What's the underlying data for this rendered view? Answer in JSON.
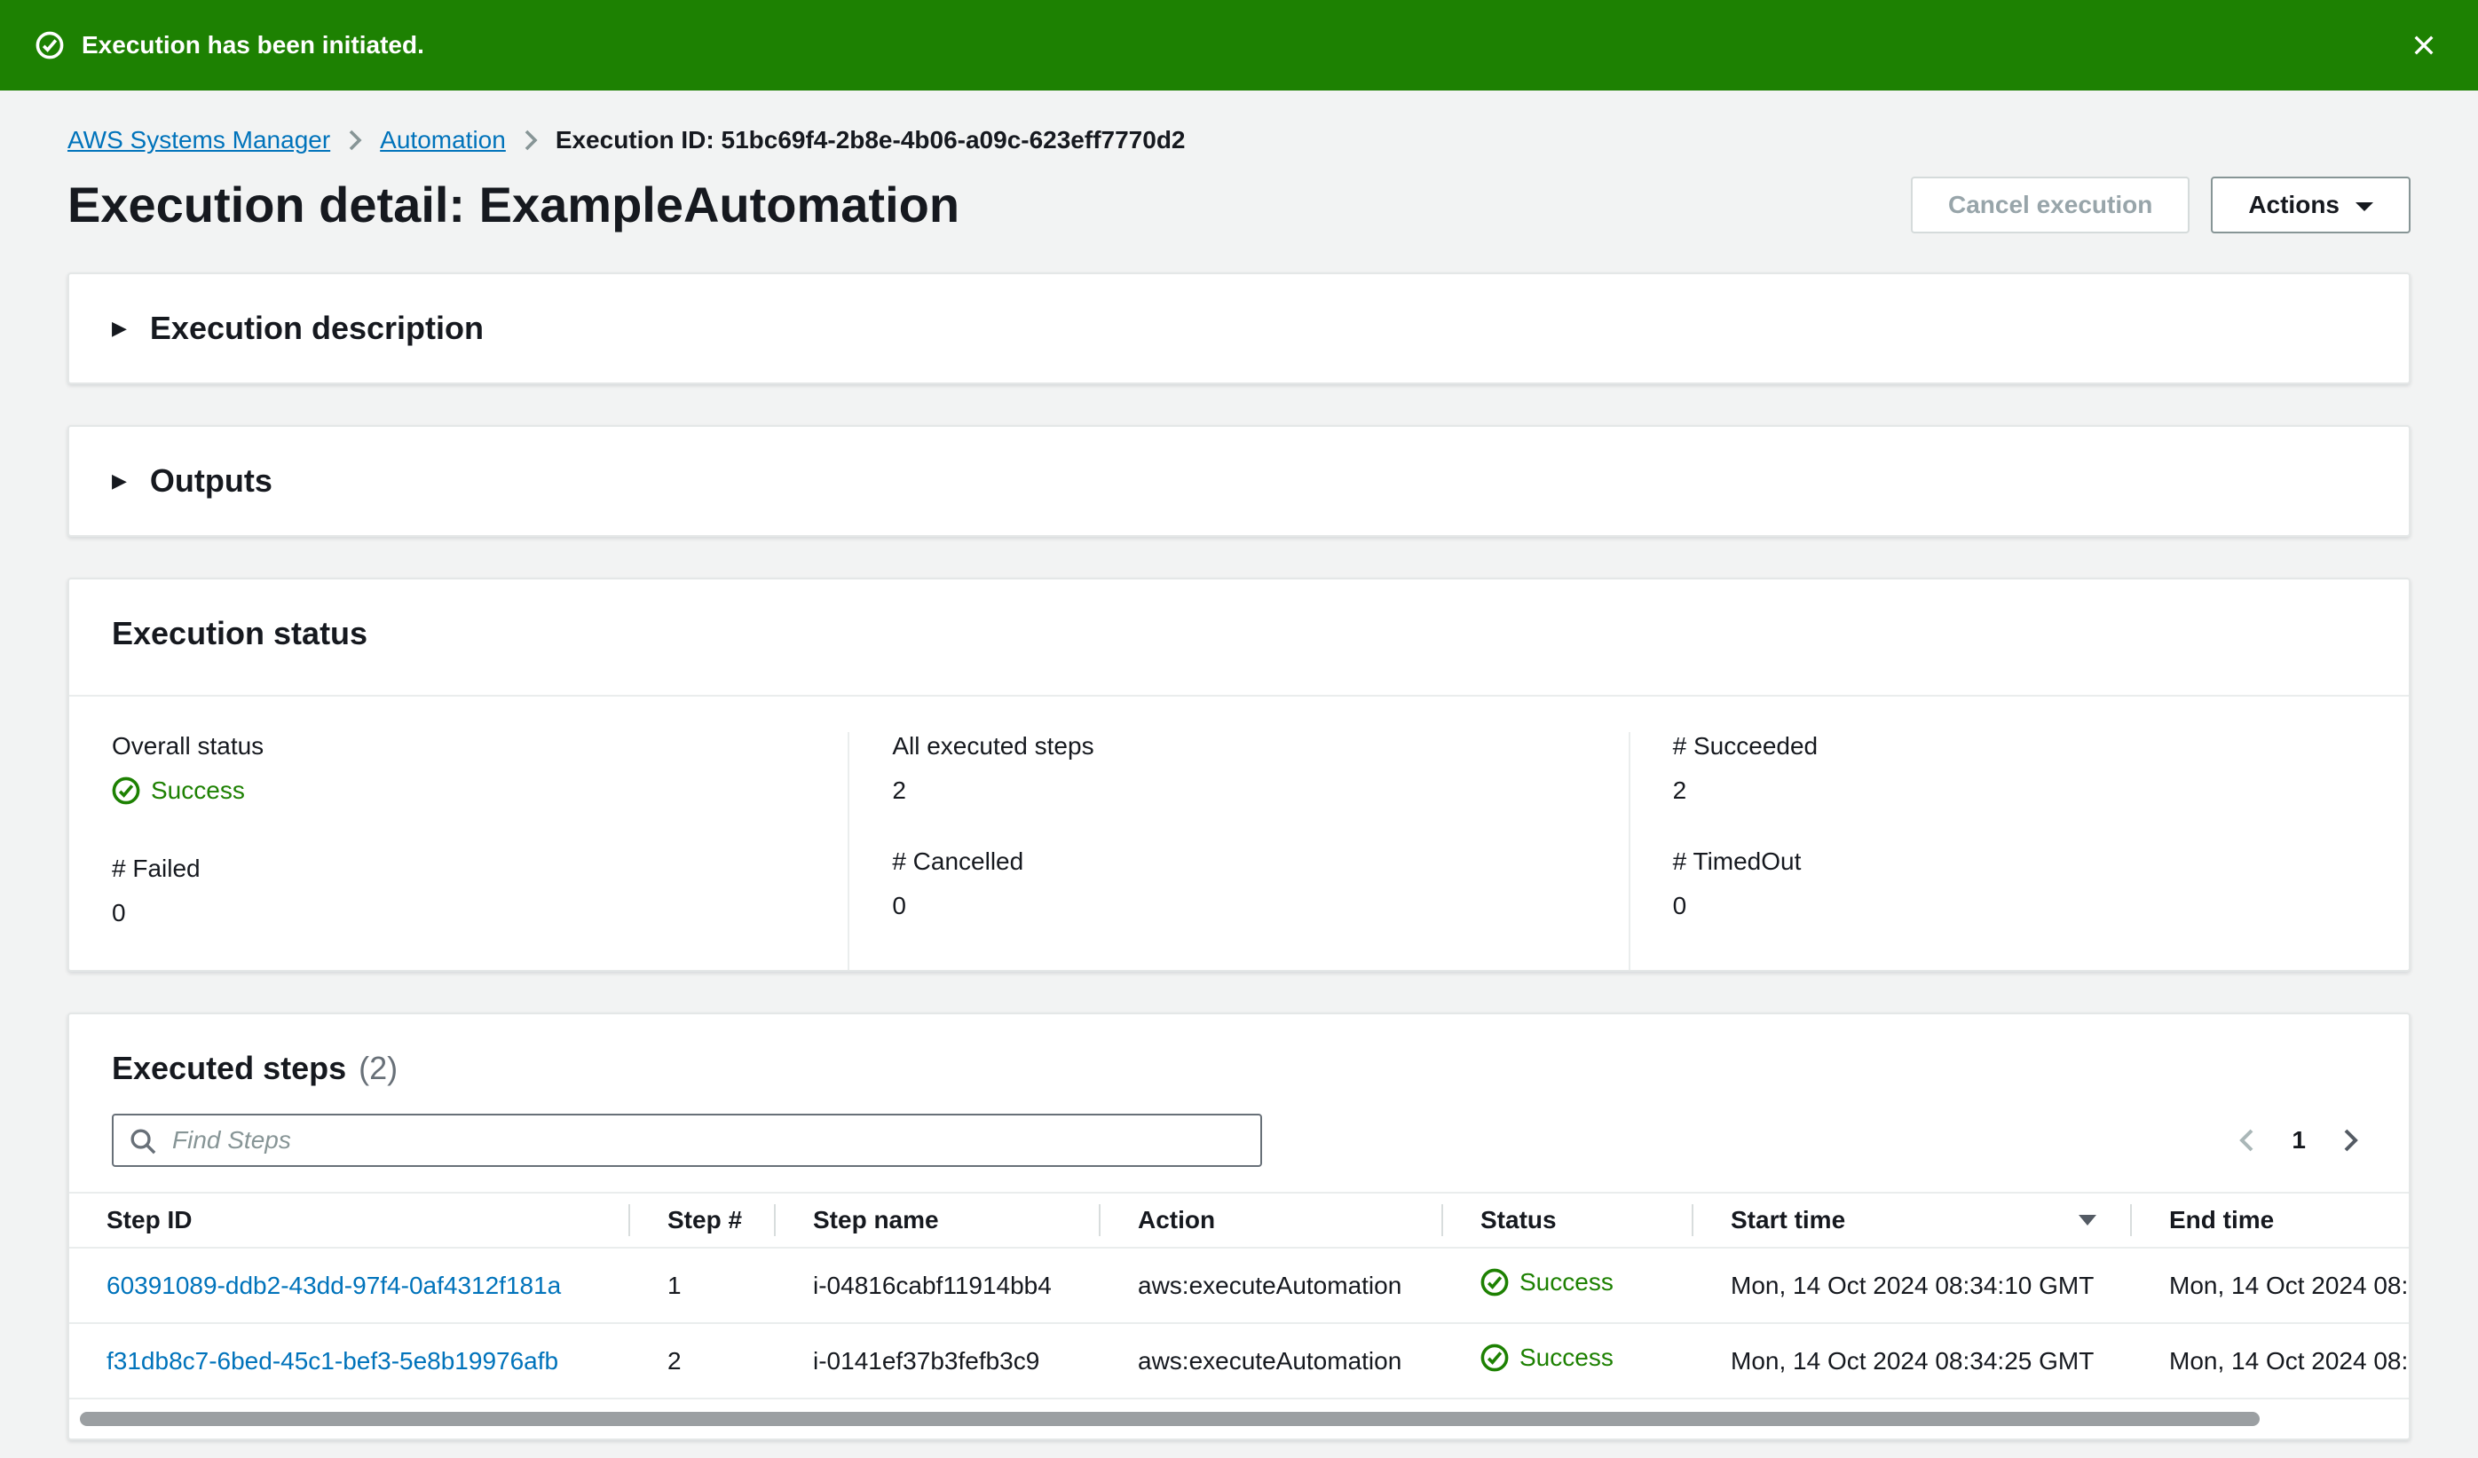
{
  "flashbar": {
    "message": "Execution has been initiated."
  },
  "breadcrumb": {
    "items": [
      {
        "label": "AWS Systems Manager"
      },
      {
        "label": "Automation"
      },
      {
        "label": "Execution ID: 51bc69f4-2b8e-4b06-a09c-623eff7770d2"
      }
    ]
  },
  "header": {
    "title": "Execution detail: ExampleAutomation",
    "cancel_button": "Cancel execution",
    "actions_button": "Actions"
  },
  "collapsed_sections": {
    "execution_description": "Execution description",
    "outputs": "Outputs"
  },
  "execution_status": {
    "title": "Execution status",
    "fields": [
      {
        "label": "Overall status",
        "value": "Success"
      },
      {
        "label": "All executed steps",
        "value": "2"
      },
      {
        "label": "# Succeeded",
        "value": "2"
      },
      {
        "label": "# Failed",
        "value": "0"
      },
      {
        "label": "# Cancelled",
        "value": "0"
      },
      {
        "label": "# TimedOut",
        "value": "0"
      }
    ]
  },
  "executed_steps": {
    "title": "Executed steps",
    "count": "(2)",
    "search_placeholder": "Find Steps",
    "pagination": {
      "current_page": "1"
    },
    "table": {
      "columns": [
        "Step ID",
        "Step #",
        "Step name",
        "Action",
        "Status",
        "Start time",
        "End time"
      ],
      "sorted_column": "Start time",
      "sort_direction": "descending",
      "rows": [
        {
          "step_id": "60391089-ddb2-43dd-97f4-0af4312f181a",
          "step_num": "1",
          "step_name": "i-04816cabf11914bb4",
          "action": "aws:executeAutomation",
          "status": "Success",
          "start_time": "Mon, 14 Oct 2024 08:34:10 GMT",
          "end_time": "Mon, 14 Oct 2024 08:"
        },
        {
          "step_id": "f31db8c7-6bed-45c1-bef3-5e8b19976afb",
          "step_num": "2",
          "step_name": "i-0141ef37b3fefb3c9",
          "action": "aws:executeAutomation",
          "status": "Success",
          "start_time": "Mon, 14 Oct 2024 08:34:25 GMT",
          "end_time": "Mon, 14 Oct 2024 08:"
        }
      ]
    }
  },
  "icons": {
    "success_check_circle": "check inside circle",
    "expand_right_triangle": "▶",
    "caret_down": "▼",
    "sort_descending": "▼",
    "close": "✕",
    "search": "magnifier",
    "chevron_right": "›",
    "chevron_left": "‹"
  },
  "colors": {
    "flashbar_green": "#1d8102",
    "success_green": "#1d8102",
    "link_blue": "#0073bb"
  }
}
